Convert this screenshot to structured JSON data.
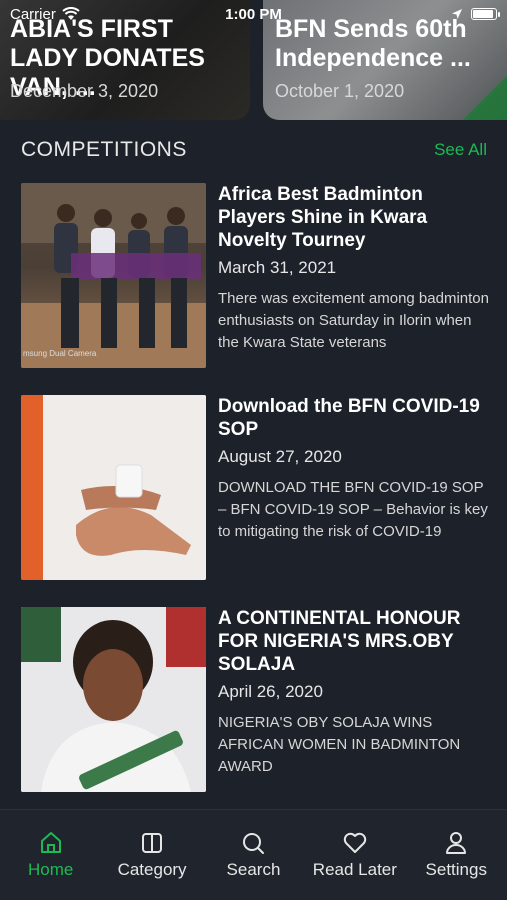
{
  "status_bar": {
    "carrier": "Carrier",
    "time": "1:00 PM"
  },
  "featured": [
    {
      "title": "ABIA'S FIRST LADY DONATES VAN, ...",
      "date": "December 3, 2020"
    },
    {
      "title": "BFN Sends 60th Independence ...",
      "date": "October 1, 2020"
    }
  ],
  "section": {
    "title": "COMPETITIONS",
    "see_all": "See All"
  },
  "articles": [
    {
      "title": "Africa Best Badminton Players Shine in Kwara Novelty Tourney",
      "date": "March 31, 2021",
      "excerpt": "There was excitement among badminton enthusiasts on Saturday in Ilorin when the Kwara State veterans",
      "image_caption": "msung Dual Camera"
    },
    {
      "title": "Download the BFN COVID-19 SOP",
      "date": "August 27, 2020",
      "excerpt": "DOWNLOAD THE BFN COVID-19 SOP – BFN COVID-19 SOP – Behavior is key to mitigating the risk of COVID-19"
    },
    {
      "title": "A CONTINENTAL HONOUR FOR NIGERIA'S MRS.OBY SOLAJA",
      "date": "April 26, 2020",
      "excerpt": "NIGERIA'S OBY SOLAJA WINS AFRICAN WOMEN IN BADMINTON AWARD"
    }
  ],
  "tabs": [
    {
      "label": "Home",
      "icon": "home-icon",
      "active": true
    },
    {
      "label": "Category",
      "icon": "category-icon",
      "active": false
    },
    {
      "label": "Search",
      "icon": "search-icon",
      "active": false
    },
    {
      "label": "Read Later",
      "icon": "heart-icon",
      "active": false
    },
    {
      "label": "Settings",
      "icon": "person-icon",
      "active": false
    }
  ],
  "colors": {
    "background": "#1d222a",
    "accent": "#1db954",
    "tab_bar": "#20252d"
  }
}
